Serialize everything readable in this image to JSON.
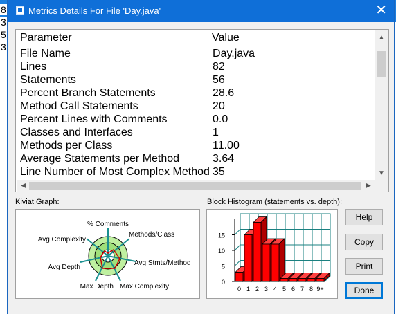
{
  "background": {
    "line_digits": [
      "8",
      "3",
      "5",
      "3"
    ]
  },
  "dialog": {
    "title": "Metrics Details For File 'Day.java'",
    "close_glyph": "✕"
  },
  "table": {
    "columns": [
      "Parameter",
      "Value"
    ],
    "rows": [
      {
        "param": "File Name",
        "value": "Day.java"
      },
      {
        "param": "Lines",
        "value": "82"
      },
      {
        "param": "Statements",
        "value": "56"
      },
      {
        "param": "Percent Branch Statements",
        "value": "28.6"
      },
      {
        "param": "Method Call Statements",
        "value": "20"
      },
      {
        "param": "Percent Lines with Comments",
        "value": "0.0"
      },
      {
        "param": "Classes and Interfaces",
        "value": "1"
      },
      {
        "param": "Methods per Class",
        "value": "11.00"
      },
      {
        "param": "Average Statements per Method",
        "value": "3.64"
      },
      {
        "param": "Line Number of Most Complex Method",
        "value": "35"
      }
    ]
  },
  "kiviat": {
    "label": "Kiviat Graph:",
    "axes": [
      "% Comments",
      "Methods/Class",
      "Avg Stmts/Method",
      "Max Complexity",
      "Max Depth",
      "Avg Depth",
      "Avg Complexity"
    ]
  },
  "histogram": {
    "label": "Block Histogram (statements vs. depth):"
  },
  "buttons": {
    "help": "Help",
    "copy": "Copy",
    "print": "Print",
    "done": "Done"
  },
  "chart_data": {
    "type": "bar",
    "categories": [
      "0",
      "1",
      "2",
      "3",
      "4",
      "5",
      "6",
      "7",
      "8",
      "9+"
    ],
    "values": [
      3,
      15,
      19,
      12,
      12,
      1,
      1,
      1,
      1,
      1
    ],
    "ylim": [
      0,
      20
    ],
    "yticks": [
      "0",
      "5",
      "10",
      "15"
    ],
    "bar_color": "#ff0000",
    "grid": true
  }
}
